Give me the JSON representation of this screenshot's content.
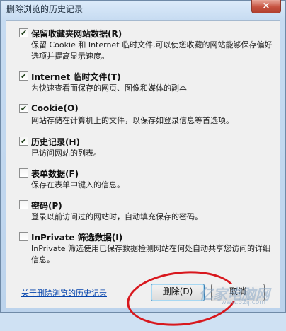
{
  "window": {
    "title": "删除浏览的历史记录",
    "close_label": "×"
  },
  "options": [
    {
      "label": "保留收藏夹网站数据(R)",
      "checked": true,
      "description": "保留 Cookie 和 Internet 临时文件,可以使您收藏的网站能够保存偏好选项并提高显示速度。"
    },
    {
      "label": "Internet 临时文件(T)",
      "checked": true,
      "description": "为快速查看而保存的网页、图像和媒体的副本"
    },
    {
      "label": "Cookie(O)",
      "checked": true,
      "description": "网站存储在计算机上的文件，以保存如登录信息等首选项。"
    },
    {
      "label": "历史记录(H)",
      "checked": true,
      "description": "已访问网站的列表。"
    },
    {
      "label": "表单数据(F)",
      "checked": false,
      "description": "保存在表单中键入的信息。"
    },
    {
      "label": "密码(P)",
      "checked": false,
      "description": "登录以前访问过的网站时，自动填充保存的密码。"
    },
    {
      "label": "InPrivate 筛选数据(I)",
      "checked": false,
      "description": "InPrivate 筛选使用已保存数据检测网站在何处自动共享您访问的详细信息。"
    }
  ],
  "footer": {
    "link": "关于删除浏览的历史记录",
    "delete_button": "删除(D)",
    "cancel_button": "取消"
  },
  "watermark": {
    "text": "亿家电脑网",
    "url": "www.52ij.com"
  }
}
